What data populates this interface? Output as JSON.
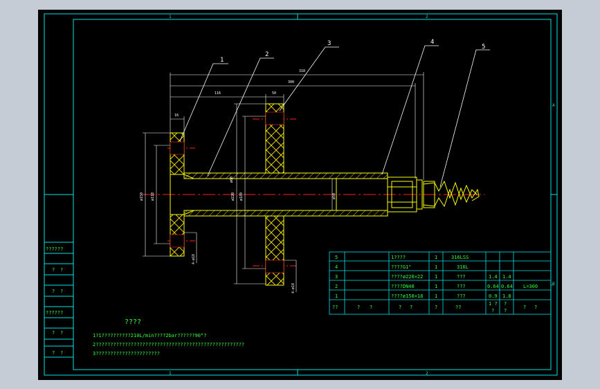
{
  "colors": {
    "background": "#c5ccd6",
    "sheet": "#000000",
    "frame": "#00e5e5",
    "part_outline": "#ffff00",
    "leader": "#ffffff",
    "dimension": "#ffffff",
    "centerline": "#ff2020",
    "hatch": "#e8d000",
    "text_green": "#33ff33"
  },
  "zones": {
    "top_1": "1",
    "top_2": "2",
    "bottom_1": "1",
    "bottom_2": "2",
    "right_a": "A",
    "right_b": "B"
  },
  "balloons": [
    "1",
    "2",
    "3",
    "4",
    "5"
  ],
  "dimensions": {
    "overall": "318",
    "length_300": "300",
    "left_part": "116",
    "disk_width": "50",
    "flange_width": "16",
    "flange_dia": "ø150",
    "bolt_circle": "ø118",
    "disk_dia": "ø220",
    "disk_inner": "ø180",
    "pipe_dia": "ø60",
    "bore": "ø50",
    "holes_left": "4-ø18",
    "holes_right": "4-ø18"
  },
  "bom": {
    "rows": [
      {
        "idx": "5",
        "name": "1????",
        "qty": "1",
        "material": "316LSS",
        "w1": "",
        "w2": "",
        "note": ""
      },
      {
        "idx": "4",
        "name": "????G1\"",
        "qty": "1",
        "material": "316L",
        "w1": "",
        "w2": "",
        "note": ""
      },
      {
        "idx": "3",
        "name": "????ø220×22",
        "qty": "1",
        "material": "???",
        "w1": "1.4",
        "w2": "1.4",
        "note": ""
      },
      {
        "idx": "2",
        "name": "????DN40",
        "qty": "1",
        "material": "???",
        "w1": "0.64",
        "w2": "0.64",
        "note": "L=300"
      },
      {
        "idx": "1",
        "name": "????ø150×18",
        "qty": "1",
        "material": "???",
        "w1": "0.9",
        "w2": "1.8",
        "note": ""
      }
    ],
    "header": {
      "idx": "??",
      "c1": "?",
      "c2": "?",
      "name": "?",
      "name2": "?",
      "qty": "?",
      "material": "??",
      "w1": "1 ?",
      "w1b": "?",
      "w2": "?",
      "w2b": "?",
      "note": "?",
      "note2": "?"
    }
  },
  "notes": {
    "title": "????",
    "line1": "1?1??????????210L/min????2bar??????90°?",
    "line2": "2???????????????????????????????????????????????????",
    "line3": "3??????????????????????"
  },
  "side_table": [
    "??????",
    "?",
    "?",
    "?",
    "?",
    "??????",
    "?",
    "?",
    "?",
    "?"
  ]
}
